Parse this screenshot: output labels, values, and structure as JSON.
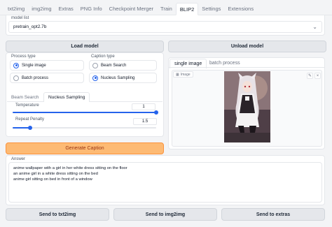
{
  "tabs": [
    "txt2img",
    "img2img",
    "Extras",
    "PNG Info",
    "Checkpoint Merger",
    "Train",
    "BLIP2",
    "Settings",
    "Extensions"
  ],
  "model": {
    "label": "model list",
    "value": "pretrain_opt2.7b"
  },
  "buttons": {
    "load": "Load model",
    "unload": "Unload model",
    "generate": "Generate Caption",
    "send_txt2img": "Send to txt2img",
    "send_img2img": "Send to img2img",
    "send_extras": "Send to extras"
  },
  "process_type": {
    "label": "Process type",
    "options": [
      "Single image",
      "Batch process"
    ],
    "selected": "Single image"
  },
  "caption_type": {
    "label": "Caption type",
    "options": [
      "Beam Search",
      "Nucleus Sampling"
    ],
    "selected": "Nucleus Sampling"
  },
  "sampling_tabs": {
    "items": [
      "Beam Search",
      "Nucleus Sampling"
    ],
    "active": "Nucleus Sampling"
  },
  "temperature": {
    "label": "Temperature",
    "value": "1",
    "fraction": 1.0
  },
  "repeat_penalty": {
    "label": "Repeat Penalty",
    "value": "1.5",
    "fraction": 0.12
  },
  "image_tabs": {
    "items": [
      "single image",
      "batch process"
    ],
    "active": "single image"
  },
  "image_label": "Image",
  "answer": {
    "label": "Answer",
    "lines": [
      "anime wallpaper with a girl in her white dress sitting on the floor",
      "an anime girl in a white dress sitting on the bed",
      "anime girl sitting on bed in front of a window"
    ]
  },
  "icons": {
    "edit": "pencil-icon",
    "close": "close-icon",
    "image": "image-icon",
    "chevron": "chevron-down-icon"
  },
  "colors": {
    "accent": "#2563eb",
    "generate_bg": "#fdba74",
    "generate_text": "#9a3412"
  }
}
